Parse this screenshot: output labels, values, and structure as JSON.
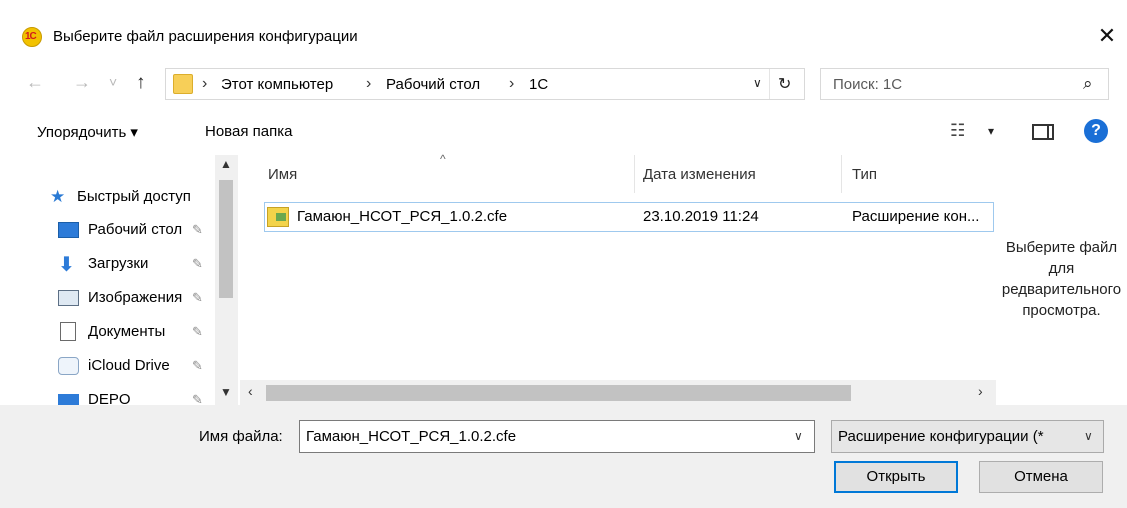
{
  "window": {
    "title": "Выберите файл расширения конфигурации",
    "app_icon_text": "1С",
    "close_glyph": "✕"
  },
  "nav": {
    "back_glyph": "←",
    "forward_glyph": "→",
    "recent_glyph": "˅",
    "up_glyph": "↑"
  },
  "address": {
    "breadcrumbs": [
      "Этот компьютер",
      "Рабочий стол",
      "1С"
    ],
    "separator": "›",
    "dropdown_glyph": "∨",
    "refresh_glyph": "↻"
  },
  "search": {
    "placeholder": "Поиск: 1С",
    "icon_glyph": "⌕"
  },
  "toolbar": {
    "organize_label": "Упорядочить ▾",
    "new_folder_label": "Новая папка",
    "view_glyph": "☷",
    "view_dd_glyph": "▾",
    "help_glyph": "?"
  },
  "sidebar": {
    "items": [
      {
        "label": "Быстрый доступ",
        "icon": "star-icon",
        "pinned": false
      },
      {
        "label": "Рабочий стол",
        "icon": "desktop-icon",
        "pinned": true
      },
      {
        "label": "Загрузки",
        "icon": "download-icon",
        "pinned": true
      },
      {
        "label": "Изображения",
        "icon": "pictures-icon",
        "pinned": true
      },
      {
        "label": "Документы",
        "icon": "documents-icon",
        "pinned": true
      },
      {
        "label": "iCloud Drive",
        "icon": "cloud-icon",
        "pinned": true
      },
      {
        "label": "DEPO",
        "icon": "folder-icon",
        "pinned": true
      }
    ],
    "pin_glyph": "✎"
  },
  "filelist": {
    "columns": [
      "Имя",
      "Дата изменения",
      "Тип"
    ],
    "sort_glyph": "^",
    "rows": [
      {
        "name": "Гамаюн_НСОТ_РСЯ_1.0.2.cfe",
        "date": "23.10.2019 11:24",
        "type": "Расширение кон..."
      }
    ]
  },
  "preview": {
    "text": "Выберите файл для редварительного просмотра."
  },
  "bottom": {
    "filename_label": "Имя файла:",
    "filename_value": "Гамаюн_НСОТ_РСЯ_1.0.2.cfe",
    "filetype_value": "Расширение конфигурации (*",
    "open_label": "Открыть",
    "cancel_label": "Отмена"
  },
  "colors": {
    "accent": "#0078d7",
    "selection_border": "#9fc9ee",
    "folder": "#f7cf58"
  }
}
